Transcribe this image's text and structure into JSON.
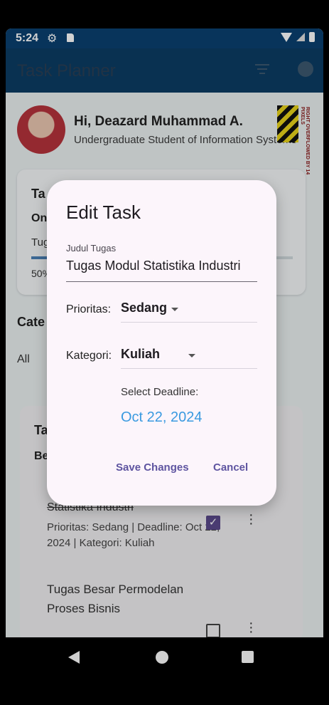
{
  "status_bar": {
    "time": "5:24",
    "icons": [
      "gear-icon",
      "sd-card-icon",
      "wifi-icon",
      "signal-icon",
      "battery-icon"
    ]
  },
  "app_bar": {
    "title": "Task Planner",
    "icons": [
      "filter-icon",
      "pie-chart-icon"
    ]
  },
  "profile": {
    "greeting": "Hi, Deazard Muhammad A.",
    "subtitle": "Undergraduate Student of Information Systems",
    "overflow_warning": "RIGHT OVERFLOWED BY 14 PIXELS"
  },
  "summary_card": {
    "title": "Ta",
    "subtitle": "On",
    "item": "Tug",
    "percent": "50%",
    "progress": 0.5
  },
  "category": {
    "title": "Cate",
    "selected": "All"
  },
  "task_card": {
    "title": "Ta",
    "subtitle": "Be",
    "tasks": [
      {
        "name": "Statistika Industri",
        "details": "Prioritas: Sedang | Deadline: Oct 22, 2024 | Kategori: Kuliah",
        "done": true
      },
      {
        "name": "Tugas Besar Permodelan Proses Bisnis",
        "done": false
      }
    ]
  },
  "dialog": {
    "title": "Edit Task",
    "title_field_label": "Judul Tugas",
    "title_field_value": "Tugas Modul Statistika Industri",
    "priority_label": "Prioritas:",
    "priority_value": "Sedang",
    "category_label": "Kategori:",
    "category_value": "Kuliah",
    "deadline_label": "Select Deadline:",
    "deadline_value": "Oct 22, 2024",
    "save_label": "Save Changes",
    "cancel_label": "Cancel"
  },
  "colors": {
    "app_bar": "#0b3c63",
    "status_bar": "#0a4070",
    "dialog_bg": "#fcf5fb",
    "accent_text": "#5e54a0",
    "date_link": "#3a9ae0",
    "checkbox": "#5b4a8c"
  }
}
